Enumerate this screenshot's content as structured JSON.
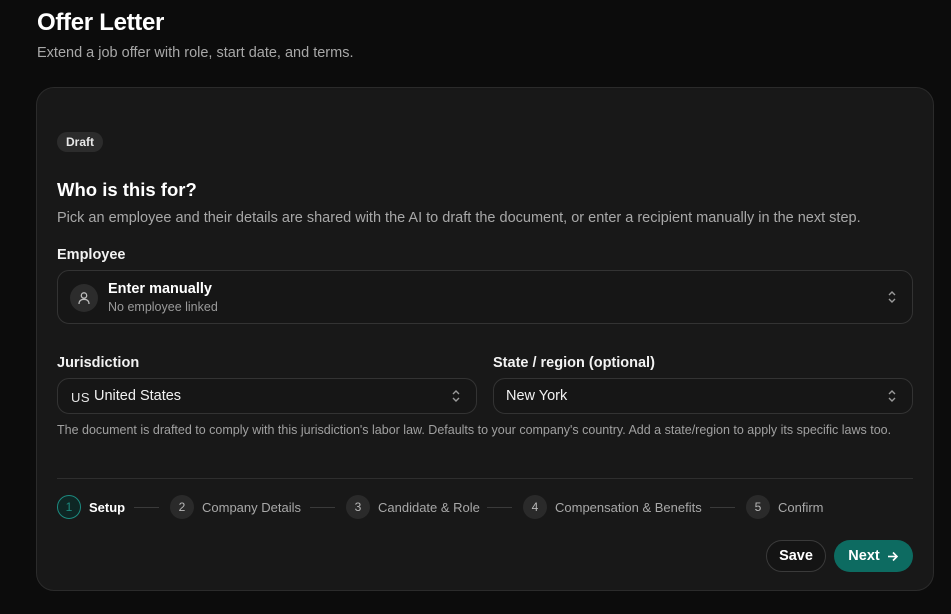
{
  "header": {
    "title": "Offer Letter",
    "subtitle": "Extend a job offer with role, start date, and terms."
  },
  "card": {
    "badge": "Draft",
    "section_title": "Who is this for?",
    "section_desc": "Pick an employee and their details are shared with the AI to draft the document, or enter a recipient manually in the next step.",
    "employee": {
      "label": "Employee",
      "value": "Enter manually",
      "subtext": "No employee linked"
    },
    "jurisdiction": {
      "label": "Jurisdiction",
      "country_code": "US",
      "value": "United States"
    },
    "state": {
      "label": "State / region (optional)",
      "value": "New York"
    },
    "help_text": "The document is drafted to comply with this jurisdiction's labor law. Defaults to your company's country. Add a state/region to apply its specific laws too.",
    "steps": [
      {
        "number": "1",
        "label": "Setup",
        "active": true
      },
      {
        "number": "2",
        "label": "Company Details",
        "active": false
      },
      {
        "number": "3",
        "label": "Candidate & Role",
        "active": false
      },
      {
        "number": "4",
        "label": "Compensation & Benefits",
        "active": false
      },
      {
        "number": "5",
        "label": "Confirm",
        "active": false
      }
    ],
    "actions": {
      "save_label": "Save",
      "next_label": "Next"
    }
  },
  "colors": {
    "accent": "#0d6b61",
    "accent_ring": "#1c8a7f",
    "background": "#0c0c0c",
    "card": "#181818"
  },
  "icons": {
    "avatar": "user-icon",
    "select": "chevron-up-down-icon",
    "next": "arrow-right-icon"
  }
}
